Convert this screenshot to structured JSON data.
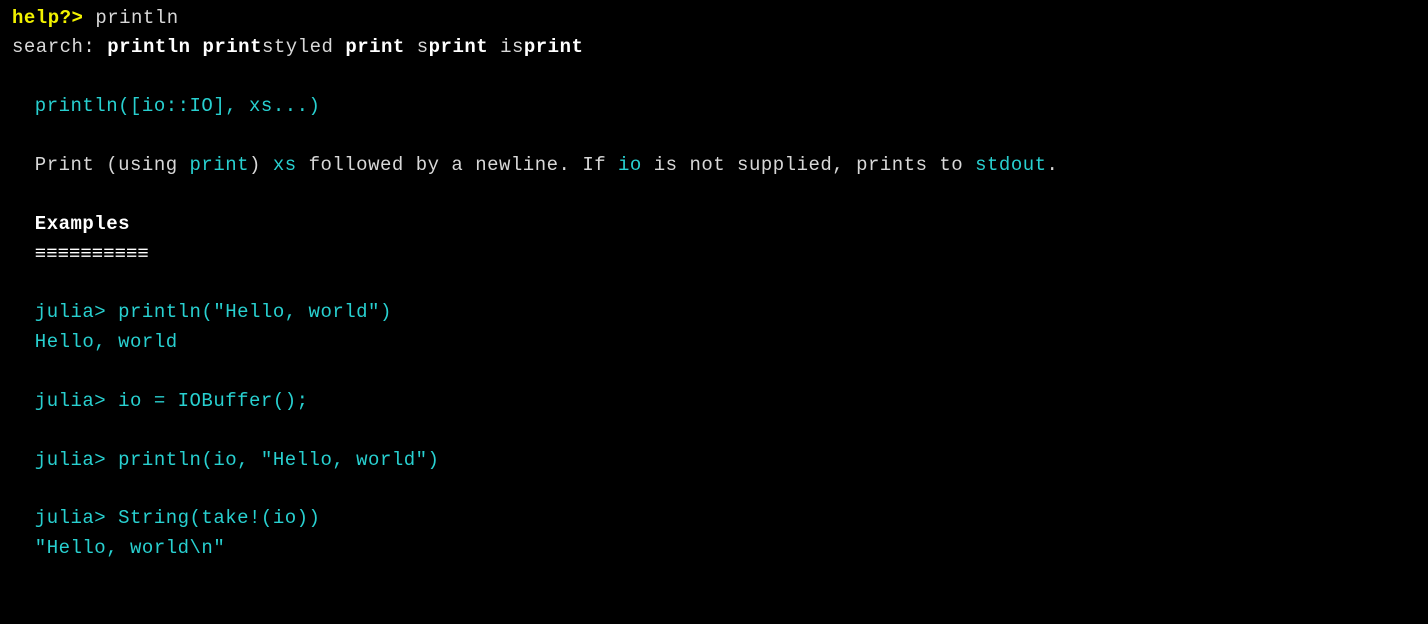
{
  "prompt": {
    "label": "help?>",
    "input": "println"
  },
  "search": {
    "label": "search:",
    "results": [
      {
        "pre": "",
        "bold": "println",
        "post": ""
      },
      {
        "pre": "",
        "bold": "print",
        "post": "styled"
      },
      {
        "pre": "",
        "bold": "print",
        "post": ""
      },
      {
        "pre": "s",
        "bold": "print",
        "post": ""
      },
      {
        "pre": "is",
        "bold": "print",
        "post": ""
      }
    ]
  },
  "signature": "println([io::IO], xs...)",
  "description": {
    "t1": "Print (using ",
    "link1": "print",
    "t2": ") ",
    "arg1": "xs",
    "t3": " followed by a newline. If ",
    "arg2": "io",
    "t4": " is not supplied, prints to ",
    "link2": "stdout",
    "t5": "."
  },
  "examples": {
    "heading": "Examples",
    "rule": "≡≡≡≡≡≡≡≡≡≡",
    "lines": [
      "julia> println(\"Hello, world\")",
      "Hello, world",
      "",
      "julia> io = IOBuffer();",
      "",
      "julia> println(io, \"Hello, world\")",
      "",
      "julia> String(take!(io))",
      "\"Hello, world\\n\""
    ]
  }
}
